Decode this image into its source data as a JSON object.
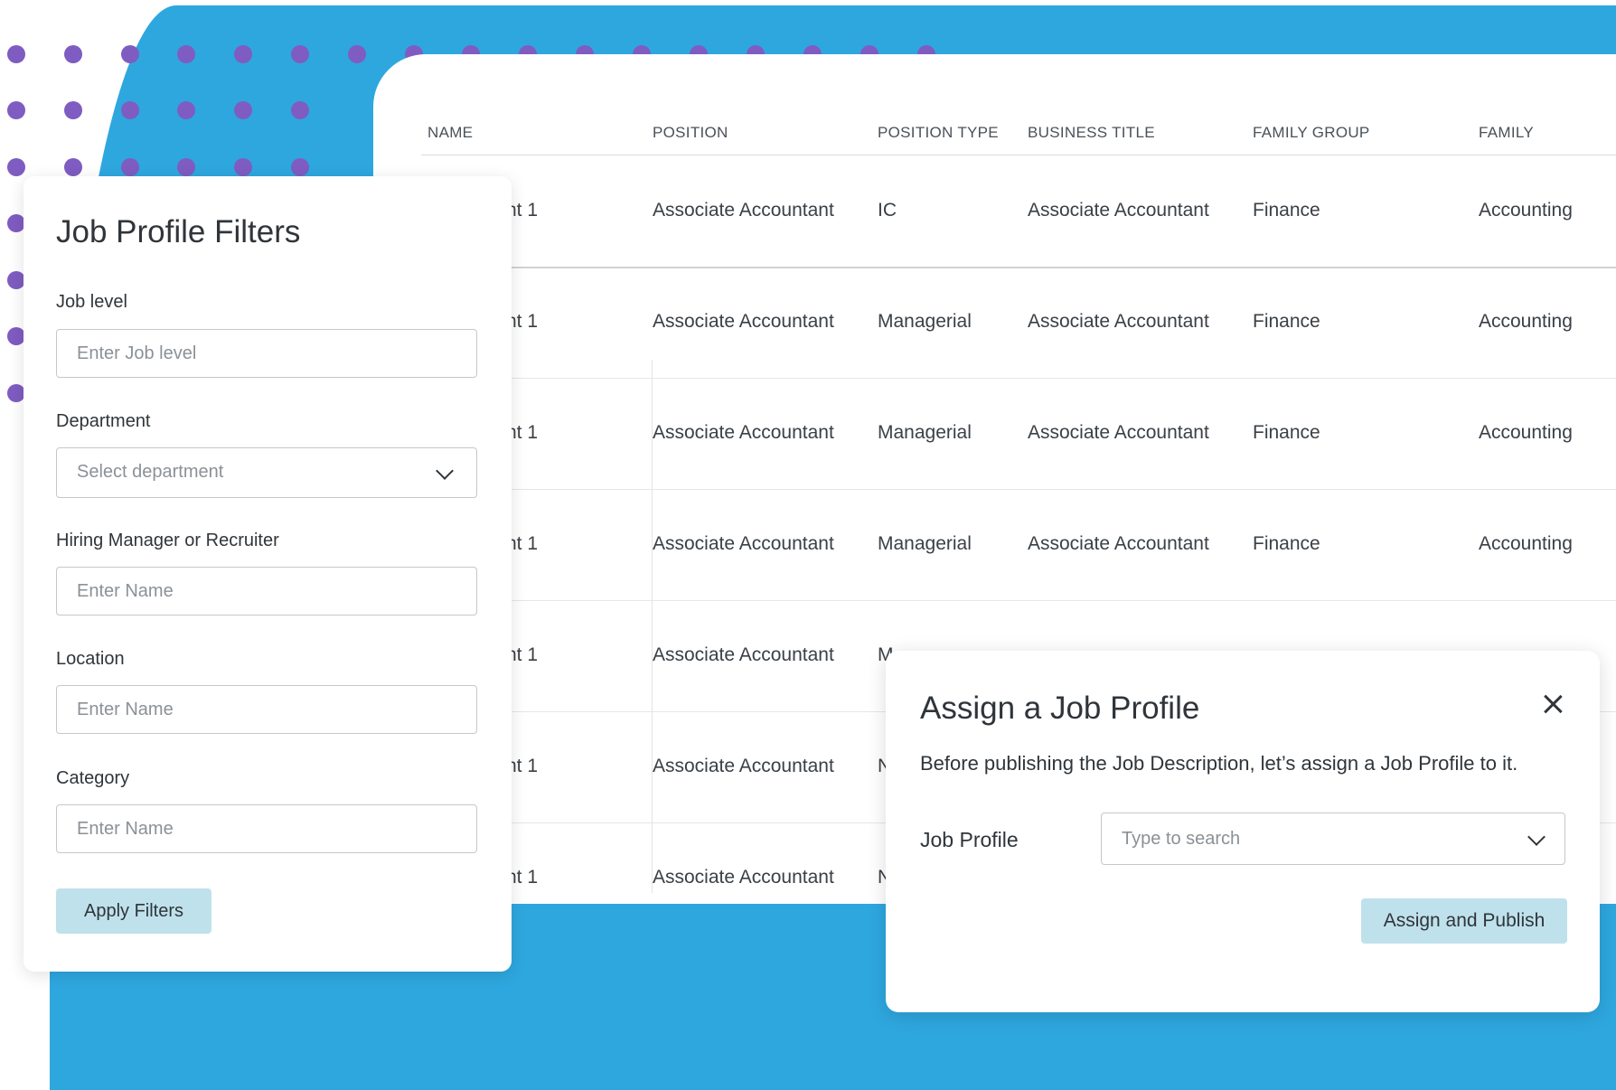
{
  "table": {
    "headers": {
      "name": "NAME",
      "position": "POSITION",
      "position_type": "POSITION TYPE",
      "business_title": "BUSINESS TITLE",
      "family_group": "FAMILY GROUP",
      "family": "FAMILY"
    },
    "rows": [
      {
        "name": "nt 1",
        "position": "Associate Accountant",
        "position_type": "IC",
        "business_title": "Associate Accountant",
        "family_group": "Finance",
        "family": "Accounting"
      },
      {
        "name": "nt 1",
        "position": "Associate Accountant",
        "position_type": "Managerial",
        "business_title": "Associate Accountant",
        "family_group": "Finance",
        "family": "Accounting"
      },
      {
        "name": "nt 1",
        "position": "Associate Accountant",
        "position_type": "Managerial",
        "business_title": "Associate Accountant",
        "family_group": "Finance",
        "family": "Accounting"
      },
      {
        "name": "nt 1",
        "position": "Associate Accountant",
        "position_type": "Managerial",
        "business_title": "Associate Accountant",
        "family_group": "Finance",
        "family": "Accounting"
      },
      {
        "name": "nt 1",
        "position": "Associate Accountant",
        "position_type": "M",
        "business_title": "",
        "family_group": "",
        "family": ""
      },
      {
        "name": "nt 1",
        "position": "Associate Accountant",
        "position_type": "N",
        "business_title": "",
        "family_group": "",
        "family": ""
      },
      {
        "name": "nt 1",
        "position": "Associate Accountant",
        "position_type": "N",
        "business_title": "",
        "family_group": "",
        "family": ""
      }
    ]
  },
  "filters": {
    "title": "Job Profile Filters",
    "job_level": {
      "label": "Job level",
      "placeholder": "Enter Job level"
    },
    "department": {
      "label": "Department",
      "placeholder": "Select department"
    },
    "hiring_manager": {
      "label": "Hiring Manager or Recruiter",
      "placeholder": "Enter Name"
    },
    "location": {
      "label": "Location",
      "placeholder": "Enter Name"
    },
    "category": {
      "label": "Category",
      "placeholder": "Enter Name"
    },
    "apply_label": "Apply Filters"
  },
  "modal": {
    "title": "Assign a Job Profile",
    "description": "Before publishing the Job Description, let’s assign a Job Profile to it.",
    "field_label": "Job Profile",
    "placeholder": "Type to search",
    "submit_label": "Assign and Publish",
    "close_icon": "close-icon"
  },
  "colors": {
    "background_blue": "#2ea7df",
    "dot_purple": "#7f5cc1",
    "button_fill": "#bfe1ec"
  }
}
